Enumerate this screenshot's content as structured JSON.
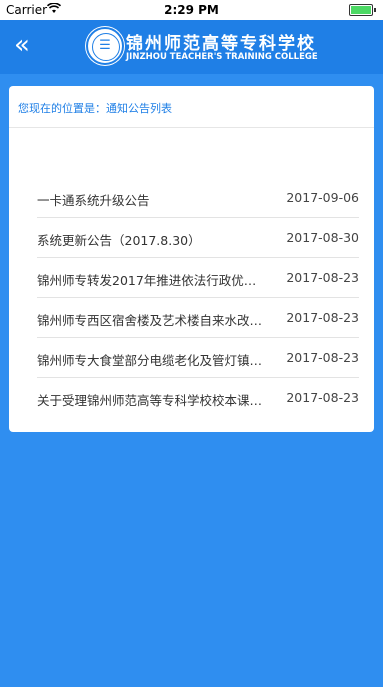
{
  "status_bar": {
    "carrier": "Carrier",
    "time": "2:29 PM",
    "battery_percent": 100
  },
  "header": {
    "back_icon": "double-chevron-left-icon",
    "school_name_cn": "锦州师范高等专科学校",
    "school_name_en": "JINZHOU TEACHER'S TRAINING COLLEGE"
  },
  "breadcrumb": {
    "prefix": "您现在的位置是：",
    "current": "通知公告列表"
  },
  "notices": [
    {
      "title": "一卡通系统升级公告",
      "date": "2017-09-06"
    },
    {
      "title": "系统更新公告（2017.8.30）",
      "date": "2017-08-30"
    },
    {
      "title": "锦州师专转发2017年推进依法行政优…",
      "date": "2017-08-23"
    },
    {
      "title": "锦州师专西区宿舍楼及艺术楼自来水改…",
      "date": "2017-08-23"
    },
    {
      "title": "锦州师专大食堂部分电缆老化及管灯镇…",
      "date": "2017-08-23"
    },
    {
      "title": "关于受理锦州师范高等专科学校校本课…",
      "date": "2017-08-23"
    }
  ],
  "colors": {
    "accent": "#1f7fe6",
    "background": "#2f8ef0"
  }
}
